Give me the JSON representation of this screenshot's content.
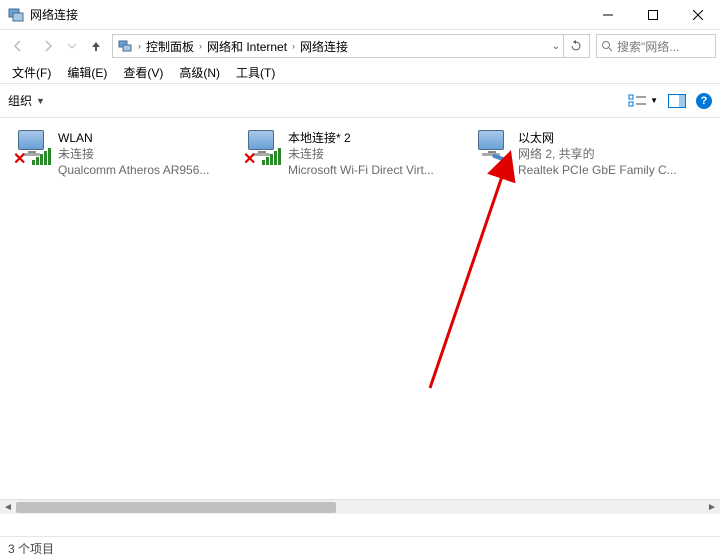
{
  "window": {
    "title": "网络连接",
    "minimize_tooltip": "最小化",
    "maximize_tooltip": "最大化",
    "close_tooltip": "关闭"
  },
  "breadcrumbs": {
    "root_icon": "control-panel",
    "segments": [
      "控制面板",
      "网络和 Internet",
      "网络连接"
    ]
  },
  "search": {
    "placeholder": "搜索\"网络..."
  },
  "menubar": {
    "items": [
      "文件(F)",
      "编辑(E)",
      "查看(V)",
      "高级(N)",
      "工具(T)"
    ]
  },
  "toolbar": {
    "organize_label": "组织",
    "help_label": "?"
  },
  "connections": [
    {
      "name": "WLAN",
      "status": "未连接",
      "adapter": "Qualcomm Atheros AR956...",
      "has_signal_bars": true,
      "has_red_x": true,
      "has_cable": false
    },
    {
      "name": "本地连接* 2",
      "status": "未连接",
      "adapter": "Microsoft Wi-Fi Direct Virt...",
      "has_signal_bars": true,
      "has_red_x": true,
      "has_cable": false
    },
    {
      "name": "以太网",
      "status": "网络 2, 共享的",
      "adapter": "Realtek PCIe GbE Family C...",
      "has_signal_bars": false,
      "has_red_x": false,
      "has_cable": true
    }
  ],
  "statusbar": {
    "text": "3 个项目"
  }
}
